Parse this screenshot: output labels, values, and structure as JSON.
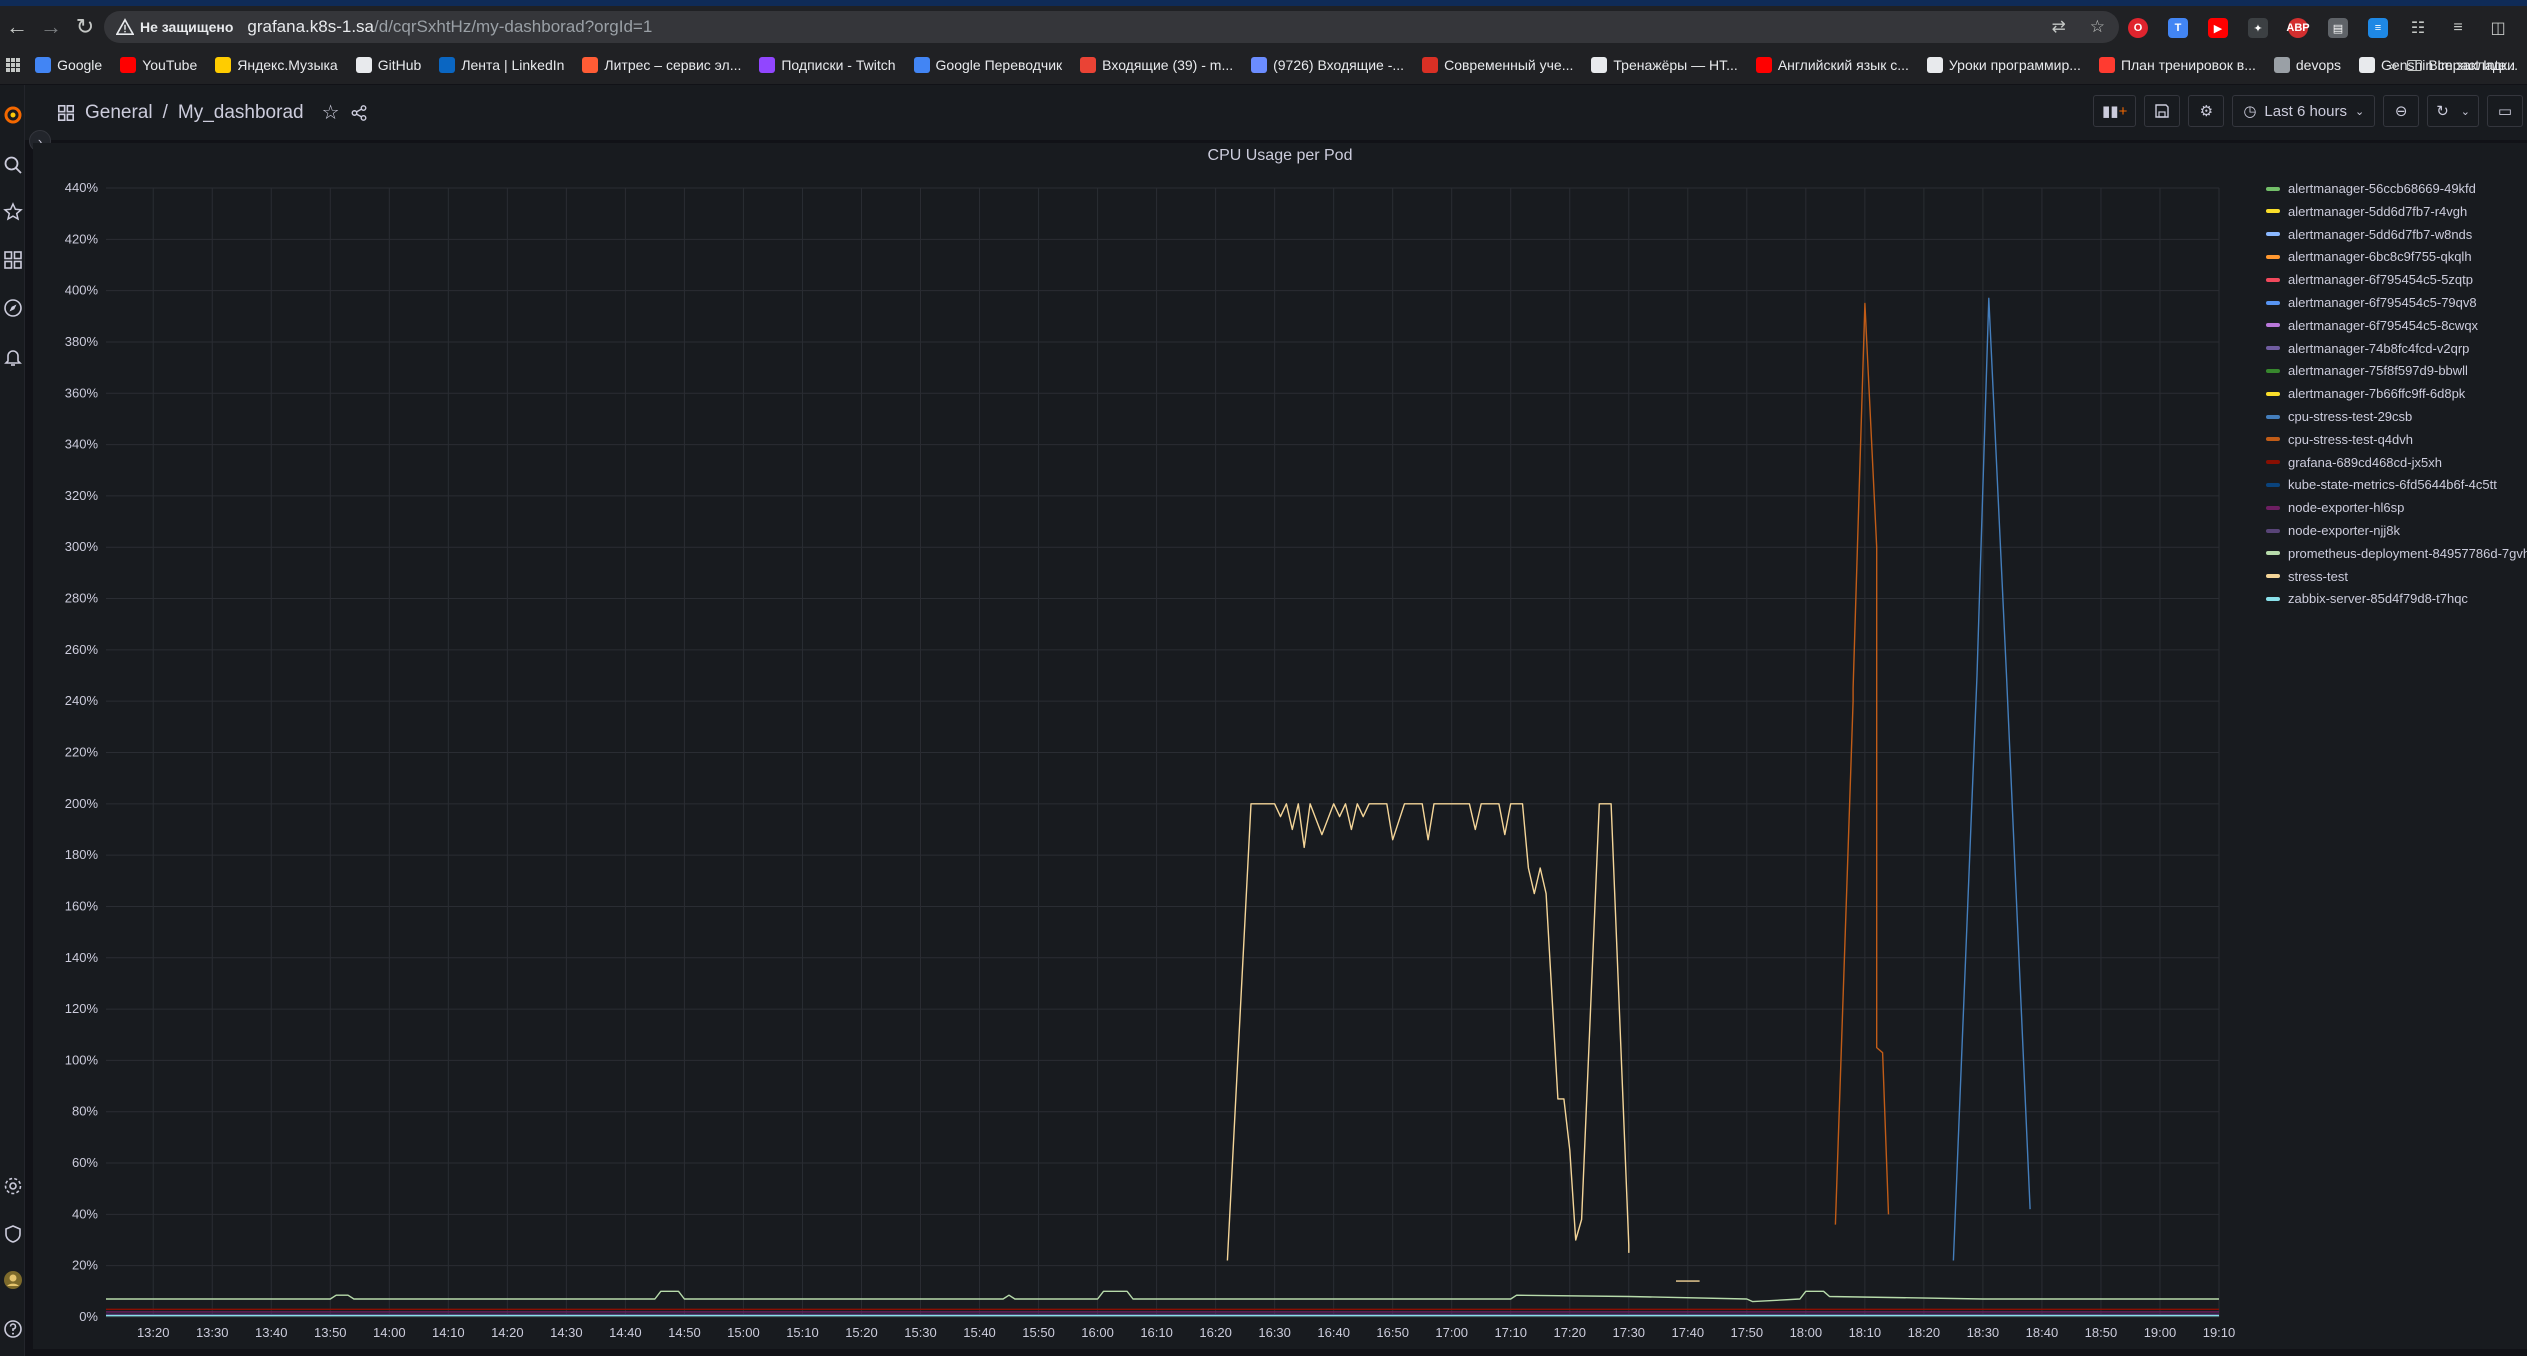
{
  "browser": {
    "security_label": "Не защищено",
    "url_host": "grafana.k8s-1.sa",
    "url_path": "/d/cqrSxhtHz/my-dashborad?orgId=1",
    "bookmarks": [
      {
        "label": "Google",
        "color": "#4285f4"
      },
      {
        "label": "YouTube",
        "color": "#ff0000"
      },
      {
        "label": "Яндекс.Музыка",
        "color": "#ffcc00"
      },
      {
        "label": "GitHub",
        "color": "#e8eaed"
      },
      {
        "label": "Лента | LinkedIn",
        "color": "#0a66c2"
      },
      {
        "label": "Литрес – сервис эл...",
        "color": "#ff5c35"
      },
      {
        "label": "Подписки - Twitch",
        "color": "#9146ff"
      },
      {
        "label": "Google Переводчик",
        "color": "#4285f4"
      },
      {
        "label": "Входящие (39) - m...",
        "color": "#ea4335"
      },
      {
        "label": "(9726) Входящие -...",
        "color": "#6b8cff"
      },
      {
        "label": "Современный учe...",
        "color": "#d93025"
      },
      {
        "label": "Тренажёры — HT...",
        "color": "#e8eaed"
      },
      {
        "label": "Английский язык c...",
        "color": "#ff0000"
      },
      {
        "label": "Уроки программир...",
        "color": "#e8eaed"
      },
      {
        "label": "План тренировок в...",
        "color": "#ff3b30"
      },
      {
        "label": "devops",
        "color": "#9aa0a6"
      },
      {
        "label": "Genshin Impact Inte...",
        "color": "#e8eaed"
      }
    ],
    "all_bookmarks_label": "Все закладки"
  },
  "grafana": {
    "breadcrumb_folder": "General",
    "breadcrumb_separator": "/",
    "dashboard_title": "My_dashborad",
    "time_range_label": "Last 6 hours",
    "panel_title": "CPU Usage per Pod"
  },
  "chart_data": {
    "type": "line",
    "title": "CPU Usage per Pod",
    "y_unit": "%",
    "ylim": [
      0,
      440
    ],
    "y_ticks": [
      "0%",
      "20%",
      "40%",
      "60%",
      "80%",
      "100%",
      "120%",
      "140%",
      "160%",
      "180%",
      "200%",
      "220%",
      "240%",
      "260%",
      "280%",
      "300%",
      "320%",
      "340%",
      "360%",
      "380%",
      "400%",
      "420%",
      "440%"
    ],
    "x_ticks": [
      "13:20",
      "13:30",
      "13:40",
      "13:50",
      "14:00",
      "14:10",
      "14:20",
      "14:30",
      "14:40",
      "14:50",
      "15:00",
      "15:10",
      "15:20",
      "15:30",
      "15:40",
      "15:50",
      "16:00",
      "16:10",
      "16:20",
      "16:30",
      "16:40",
      "16:50",
      "17:00",
      "17:10",
      "17:20",
      "17:30",
      "17:40",
      "17:50",
      "18:00",
      "18:10",
      "18:20",
      "18:30",
      "18:40",
      "18:50",
      "19:00",
      "19:10"
    ],
    "x_range": [
      "13:12",
      "19:10"
    ],
    "grid": true,
    "legend_position": "right",
    "series": [
      {
        "name": "alertmanager-56ccb68669-49kfd",
        "color": "#73bf69",
        "points": []
      },
      {
        "name": "alertmanager-5dd6d7fb7-r4vgh",
        "color": "#fade2a",
        "points": []
      },
      {
        "name": "alertmanager-5dd6d7fb7-w8nds",
        "color": "#8ab8ff",
        "points": []
      },
      {
        "name": "alertmanager-6bc8c9f755-qkqlh",
        "color": "#ff9830",
        "points": []
      },
      {
        "name": "alertmanager-6f795454c5-5zqtp",
        "color": "#f2495c",
        "points": []
      },
      {
        "name": "alertmanager-6f795454c5-79qv8",
        "color": "#5794f2",
        "points": []
      },
      {
        "name": "alertmanager-6f795454c5-8cwqx",
        "color": "#b877d9",
        "points": []
      },
      {
        "name": "alertmanager-74b8fc4fcd-v2qrp",
        "color": "#705da0",
        "points": []
      },
      {
        "name": "alertmanager-75f8f597d9-bbwll",
        "color": "#37872d",
        "points": []
      },
      {
        "name": "alertmanager-7b66ffc9ff-6d8pk",
        "color": "#fade2a",
        "points": []
      },
      {
        "name": "cpu-stress-test-29csb",
        "color": "#447ebc",
        "points": [
          [
            "18:25",
            22
          ],
          [
            "18:29",
            250
          ],
          [
            "18:31",
            397
          ],
          [
            "18:34",
            250
          ],
          [
            "18:38",
            42
          ]
        ]
      },
      {
        "name": "cpu-stress-test-q4dvh",
        "color": "#c15c17",
        "points": [
          [
            "18:05",
            36
          ],
          [
            "18:08",
            240
          ],
          [
            "18:08",
            245
          ],
          [
            "18:10",
            395
          ],
          [
            "18:12",
            300
          ],
          [
            "18:12",
            105
          ],
          [
            "18:13",
            103
          ],
          [
            "18:14",
            40
          ]
        ]
      },
      {
        "name": "grafana-689cd468cd-jx5xh",
        "color": "#890f02",
        "points": [
          [
            "13:12",
            3
          ],
          [
            "19:10",
            3
          ]
        ]
      },
      {
        "name": "kube-state-metrics-6fd5644b6f-4c5tt",
        "color": "#0a437c",
        "points": [
          [
            "13:12",
            1
          ],
          [
            "19:10",
            1
          ]
        ]
      },
      {
        "name": "node-exporter-hl6sp",
        "color": "#6d1f62",
        "points": [
          [
            "13:12",
            2
          ],
          [
            "19:10",
            2
          ]
        ]
      },
      {
        "name": "node-exporter-njj8k",
        "color": "#584477",
        "points": [
          [
            "13:12",
            1
          ],
          [
            "19:10",
            1
          ]
        ]
      },
      {
        "name": "prometheus-deployment-84957786d-7gvht",
        "color": "#b7dbab",
        "points": [
          [
            "13:12",
            7
          ],
          [
            "13:50",
            7
          ],
          [
            "13:51",
            8.5
          ],
          [
            "13:53",
            8.5
          ],
          [
            "13:54",
            7
          ],
          [
            "14:45",
            7
          ],
          [
            "14:46",
            10
          ],
          [
            "14:49",
            10
          ],
          [
            "14:50",
            7
          ],
          [
            "15:44",
            7
          ],
          [
            "15:45",
            8.5
          ],
          [
            "15:46",
            7
          ],
          [
            "16:00",
            7
          ],
          [
            "16:01",
            10
          ],
          [
            "16:05",
            10
          ],
          [
            "16:06",
            7
          ],
          [
            "17:10",
            7
          ],
          [
            "17:11",
            8.5
          ],
          [
            "17:30",
            8
          ],
          [
            "17:50",
            7
          ],
          [
            "17:51",
            6
          ],
          [
            "17:59",
            7
          ],
          [
            "18:00",
            10
          ],
          [
            "18:03",
            10
          ],
          [
            "18:04",
            8
          ],
          [
            "18:30",
            7
          ],
          [
            "19:10",
            7
          ]
        ]
      },
      {
        "name": "stress-test",
        "color": "#f4d598",
        "points": [
          [
            "16:22",
            22
          ],
          [
            "16:26",
            200
          ],
          [
            "16:30",
            200
          ],
          [
            "16:31",
            195
          ],
          [
            "16:32",
            200
          ],
          [
            "16:33",
            190
          ],
          [
            "16:34",
            200
          ],
          [
            "16:35",
            183
          ],
          [
            "16:36",
            200
          ],
          [
            "16:38",
            188
          ],
          [
            "16:40",
            200
          ],
          [
            "16:41",
            195
          ],
          [
            "16:42",
            200
          ],
          [
            "16:43",
            190
          ],
          [
            "16:44",
            200
          ],
          [
            "16:45",
            195
          ],
          [
            "16:46",
            200
          ],
          [
            "16:49",
            200
          ],
          [
            "16:50",
            186
          ],
          [
            "16:52",
            200
          ],
          [
            "16:55",
            200
          ],
          [
            "16:56",
            186
          ],
          [
            "16:57",
            200
          ],
          [
            "17:03",
            200
          ],
          [
            "17:04",
            190
          ],
          [
            "17:05",
            200
          ],
          [
            "17:08",
            200
          ],
          [
            "17:09",
            188
          ],
          [
            "17:10",
            200
          ],
          [
            "17:12",
            200
          ],
          [
            "17:13",
            175
          ],
          [
            "17:14",
            165
          ],
          [
            "17:15",
            175
          ],
          [
            "17:16",
            165
          ],
          [
            "17:18",
            85
          ],
          [
            "17:19",
            85
          ],
          [
            "17:20",
            65
          ],
          [
            "17:21",
            30
          ],
          [
            "17:22",
            38
          ],
          [
            "17:25",
            200
          ],
          [
            "17:27",
            200
          ],
          [
            "17:30",
            28
          ],
          [
            "17:30",
            25
          ]
        ]
      },
      {
        "name": "zabbix-server-85d4f79d8-t7hqc",
        "color": "#8ae1ea",
        "points": [
          [
            "13:12",
            0.5
          ],
          [
            "19:10",
            0.5
          ]
        ]
      }
    ],
    "extra_marks": [
      {
        "series": "stress-test",
        "points": [
          [
            "17:38",
            14
          ],
          [
            "17:42",
            14
          ]
        ]
      }
    ]
  }
}
